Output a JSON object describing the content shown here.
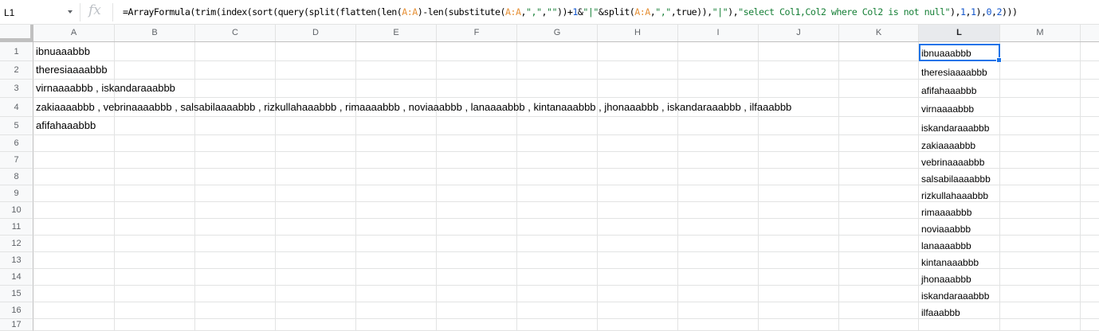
{
  "name_box": {
    "value": "L1"
  },
  "formula_bar": {
    "fx_label": "fx",
    "formula": [
      {
        "t": "=ArrayFormula(trim(index(sort(query(split(flatten(len(",
        "c": ""
      },
      {
        "t": "A:A",
        "c": "rng"
      },
      {
        "t": ")-len(substitute(",
        "c": ""
      },
      {
        "t": "A:A",
        "c": "rng"
      },
      {
        "t": ",",
        "c": ""
      },
      {
        "t": "\",\"",
        "c": "str"
      },
      {
        "t": ",",
        "c": ""
      },
      {
        "t": "\"\"",
        "c": "str"
      },
      {
        "t": "))+",
        "c": ""
      },
      {
        "t": "1",
        "c": "num"
      },
      {
        "t": "&",
        "c": ""
      },
      {
        "t": "\"|\"",
        "c": "str"
      },
      {
        "t": "&split(",
        "c": ""
      },
      {
        "t": "A:A",
        "c": "rng"
      },
      {
        "t": ",",
        "c": ""
      },
      {
        "t": "\",\"",
        "c": "str"
      },
      {
        "t": ",true)),",
        "c": ""
      },
      {
        "t": "\"|\"",
        "c": "str"
      },
      {
        "t": "),",
        "c": ""
      },
      {
        "t": "\"select Col1,Col2 where Col2 is not null\"",
        "c": "str"
      },
      {
        "t": "),",
        "c": ""
      },
      {
        "t": "1",
        "c": "num"
      },
      {
        "t": ",",
        "c": ""
      },
      {
        "t": "1",
        "c": "num"
      },
      {
        "t": "),",
        "c": ""
      },
      {
        "t": "0",
        "c": "num"
      },
      {
        "t": ",",
        "c": ""
      },
      {
        "t": "2",
        "c": "num"
      },
      {
        "t": ")))",
        "c": ""
      }
    ]
  },
  "columns": [
    "A",
    "B",
    "C",
    "D",
    "E",
    "F",
    "G",
    "H",
    "I",
    "J",
    "K",
    "L",
    "M"
  ],
  "selected_column": "L",
  "rows": [
    "1",
    "2",
    "3",
    "4",
    "5",
    "6",
    "7",
    "8",
    "9",
    "10",
    "11",
    "12",
    "13",
    "14",
    "15",
    "16",
    "17"
  ],
  "column_a": [
    "ibnuaaabbb",
    "theresiaaaabbb",
    "virnaaaabbb , iskandaraaabbb",
    "zakiaaaabbb , vebrinaaaabbb , salsabilaaaabbb , rizkullahaaabbb , rimaaaabbb , noviaaabbb , lanaaaabbb , kintanaaabbb , jhonaaabbb , iskandaraaabbb , ilfaaabbb",
    "afifahaaabbb"
  ],
  "column_l": [
    "ibnuaaabbb",
    "theresiaaaabbb",
    "afifahaaabbb",
    "virnaaaabbb",
    "iskandaraaabbb",
    "zakiaaaabbb",
    "vebrinaaaabbb",
    "salsabilaaaabbb",
    "rizkullahaaabbb",
    "rimaaaabbb",
    "noviaaabbb",
    "lanaaaabbb",
    "kintanaaabbb",
    "jhonaaabbb",
    "iskandaraaabbb",
    "ilfaaabbb"
  ],
  "colors": {
    "selection": "#1a73e8",
    "range_ref": "#e69138",
    "string_literal": "#188038",
    "number_literal": "#1155cc"
  }
}
